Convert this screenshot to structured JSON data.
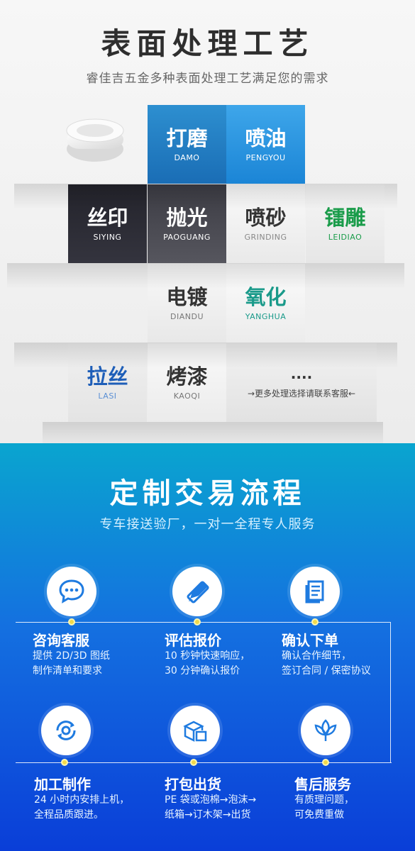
{
  "surface": {
    "title": "表面处理工艺",
    "subtitle": "睿佳吉五金多种表面处理工艺满足您的需求",
    "tiles": {
      "damo": {
        "cn": "打磨",
        "en": "DAMO"
      },
      "pengyou": {
        "cn": "喷油",
        "en": "PENGYOU"
      },
      "siying": {
        "cn": "丝印",
        "en": "SIYING"
      },
      "paoguang": {
        "cn": "抛光",
        "en": "PAOGUANG"
      },
      "grinding": {
        "cn": "喷砂",
        "en": "GRINDING"
      },
      "leidiao": {
        "cn": "镭雕",
        "en": "LEIDIAO"
      },
      "diandu": {
        "cn": "电镀",
        "en": "DIANDU"
      },
      "yanghua": {
        "cn": "氧化",
        "en": "YANGHUA"
      },
      "lasi": {
        "cn": "拉丝",
        "en": "LASI"
      },
      "kaoqi": {
        "cn": "烤漆",
        "en": "KAOQI"
      },
      "more": {
        "cn": "....",
        "en": "→更多处理选择请联系客服←"
      }
    }
  },
  "process": {
    "title": "定制交易流程",
    "subtitle": "专车接送验厂，一对一全程专人服务",
    "steps": [
      {
        "title": "咨询客服",
        "line1": "提供 2D/3D 图纸",
        "line2": "制作清单和要求",
        "icon": "chat-icon"
      },
      {
        "title": "评估报价",
        "line1": "10 秒钟快速响应，",
        "line2": "30 分钟确认报价",
        "icon": "pencil-ruler-icon"
      },
      {
        "title": "确认下单",
        "line1": "确认合作细节，",
        "line2": "签订合同 / 保密协议",
        "icon": "document-icon"
      },
      {
        "title": "加工制作",
        "line1": "24 小时内安排上机，",
        "line2": "全程品质跟进。",
        "icon": "gear-cycle-icon"
      },
      {
        "title": "打包出货",
        "line1": "PE 袋或泡棉→泡沫→",
        "line2": "纸箱→订木架→出货",
        "icon": "boxes-icon"
      },
      {
        "title": "售后服务",
        "line1": "有质理问题，",
        "line2": "可免费重做",
        "icon": "lotus-icon"
      }
    ]
  }
}
